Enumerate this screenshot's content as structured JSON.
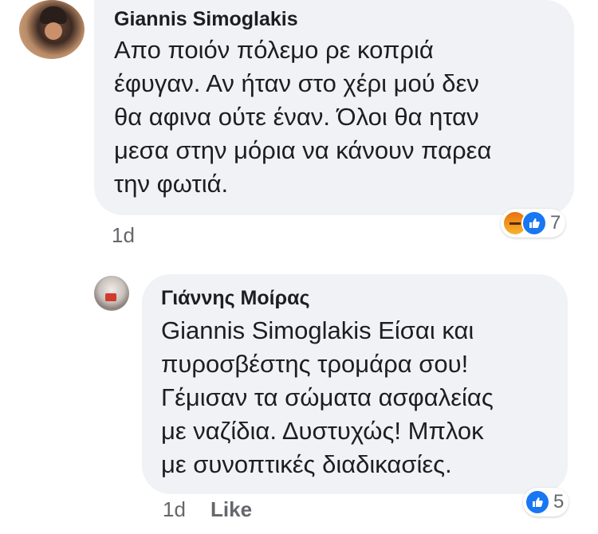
{
  "comments": [
    {
      "author": "Giannis Simoglakis",
      "text": "Απο ποιόν πόλεμο ρε κοπριά\nέφυγαν. Αν ήταν στο χέρι μού δεν\nθα αφινα ούτε έναν. Όλοι θα ηταν\nμεσα στην μόρια να κάνουν παρεα\nτην φωτιά.",
      "time": "1d",
      "reaction_icons": [
        "angry-icon",
        "like-icon"
      ],
      "reaction_count": "7"
    },
    {
      "author": "Γιάννης Μοίρας",
      "text": "Giannis Simoglakis Είσαι και\nπυροσβέστης τρομάρα σου!\nΓέμισαν τα σώματα ασφαλείας\nμε ναζίδια. Δυστυχώς! Μπλοκ\nμε συνοπτικές διαδικασίες.",
      "time": "1d",
      "like_label": "Like",
      "reaction_icons": [
        "like-icon"
      ],
      "reaction_count": "5"
    }
  ],
  "colors": {
    "bubble": "#f0f2f5",
    "like_blue": "#1877f2",
    "meta_gray": "#65676b",
    "angry_orange": "#e9710f"
  }
}
